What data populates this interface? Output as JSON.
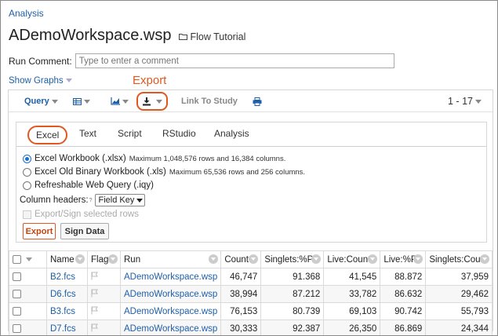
{
  "breadcrumb": "Analysis",
  "title": "ADemoWorkspace.wsp",
  "folder_link": "Flow Tutorial",
  "run_comment": {
    "label": "Run Comment:",
    "placeholder": "Type to enter a comment"
  },
  "show_graphs": "Show Graphs",
  "annotation": "Export",
  "toolbar": {
    "query": "Query",
    "link_to_study": "Link To Study",
    "pager": "1 - 17"
  },
  "export": {
    "tabs": [
      "Excel",
      "Text",
      "Script",
      "RStudio",
      "Analysis"
    ],
    "options": [
      {
        "label": "Excel Workbook (.xlsx)",
        "note": "Maximum 1,048,576 rows and 16,384 columns.",
        "selected": true
      },
      {
        "label": "Excel Old Binary Workbook (.xls)",
        "note": "Maximum 65,536 rows and 256 columns.",
        "selected": false
      },
      {
        "label": "Refreshable Web Query (.iqy)",
        "note": "",
        "selected": false
      }
    ],
    "column_headers_label": "Column headers:",
    "column_headers_sup": "?",
    "column_headers_value": "Field Key",
    "sign_rows_label": "Export/Sign selected rows",
    "export_button": "Export",
    "sign_button": "Sign Data"
  },
  "table": {
    "headers": [
      "Name",
      "Flag",
      "Run",
      "Count",
      "Singlets:%P",
      "Live:Count",
      "Live:%P",
      "Singlets:Count"
    ],
    "rows": [
      {
        "name": "B2.fcs",
        "run": "ADemoWorkspace.wsp",
        "count": "46,747",
        "singlets_p": "91.368",
        "live_count": "41,545",
        "live_p": "88.872",
        "singlets_count": "37,959"
      },
      {
        "name": "D6.fcs",
        "run": "ADemoWorkspace.wsp",
        "count": "38,994",
        "singlets_p": "87.212",
        "live_count": "33,782",
        "live_p": "86.632",
        "singlets_count": "29,462"
      },
      {
        "name": "B3.fcs",
        "run": "ADemoWorkspace.wsp",
        "count": "76,153",
        "singlets_p": "80.739",
        "live_count": "69,103",
        "live_p": "90.742",
        "singlets_count": "55,793"
      },
      {
        "name": "D7.fcs",
        "run": "ADemoWorkspace.wsp",
        "count": "30,333",
        "singlets_p": "92.387",
        "live_count": "26,350",
        "live_p": "86.869",
        "singlets_count": "24,344"
      }
    ]
  },
  "colors": {
    "accent": "#e1581f",
    "link": "#1e5fa8",
    "radio": "#1a6fd0"
  },
  "icons": [
    "folder-icon",
    "grid-icon",
    "chart-icon",
    "download-icon",
    "print-icon",
    "flag-icon"
  ]
}
